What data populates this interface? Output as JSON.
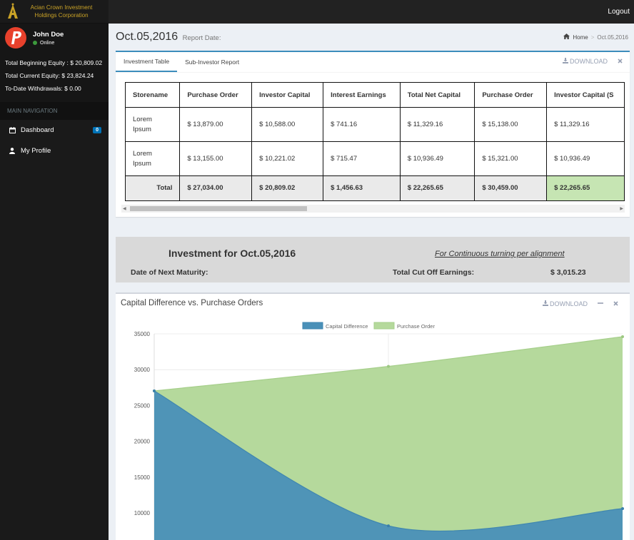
{
  "brand": {
    "name": "Acian Crown Investment Holdings Corporation",
    "logo_letter": "A"
  },
  "user": {
    "name": "John Doe",
    "status": "Online"
  },
  "equity": {
    "beginning": "Total Beginning Equity : $ 20,809.02",
    "current": "Total Current Equity: $ 23,824.24",
    "withdrawals": "To-Date Withdrawals: $ 0.00"
  },
  "nav": {
    "header": "MAIN NAVIGATION",
    "items": [
      {
        "label": "Dashboard",
        "icon": "calendar-icon",
        "badge": "0"
      },
      {
        "label": "My Profile",
        "icon": "user-icon"
      }
    ]
  },
  "topbar": {
    "logout": "Logout"
  },
  "header": {
    "title": "Oct.05,2016",
    "subtitle": "Report Date:"
  },
  "breadcrumb": {
    "home": "Home",
    "current": "Oct.05,2016"
  },
  "tabs": {
    "items": [
      "Investment Table",
      "Sub-Investor Report"
    ],
    "download": "DOWNLOAD"
  },
  "table": {
    "headers": [
      "Storename",
      "Purchase Order",
      "Investor Capital",
      "Interest Earnings",
      "Total Net Capital",
      "Purchase Order",
      "Investor Capital (S"
    ],
    "rows": [
      [
        "Lorem Ipsum",
        "$ 13,879.00",
        "$ 10,588.00",
        "$ 741.16",
        "$ 11,329.16",
        "$ 15,138.00",
        "$ 11,329.16"
      ],
      [
        "Lorem Ipsum",
        "$ 13,155.00",
        "$ 10,221.02",
        "$ 715.47",
        "$ 10,936.49",
        "$ 15,321.00",
        "$ 10,936.49"
      ]
    ],
    "total": [
      "Total",
      "$ 27,034.00",
      "$ 20,809.02",
      "$ 1,456.63",
      "$ 22,265.65",
      "$ 30,459.00",
      "$ 22,265.65"
    ]
  },
  "summary": {
    "title": "Investment for Oct.05,2016",
    "continuous": "For Continuous turning per alignment",
    "maturity": "Date of Next Maturity:",
    "cutoff_label": "Total Cut Off Earnings:",
    "cutoff_value": "$ 3,015.23"
  },
  "chart_box": {
    "title": "Capital Difference vs. Purchase Orders",
    "download": "DOWNLOAD"
  },
  "chart_data": {
    "type": "area",
    "x": [
      0,
      1,
      2
    ],
    "series": [
      {
        "name": "Capital Difference",
        "values": [
          27034,
          8200,
          10600
        ],
        "color": "#4a90b8"
      },
      {
        "name": "Purchase Order",
        "values": [
          27034,
          30459,
          34600
        ],
        "color": "#b5d99c"
      }
    ],
    "y_ticks": [
      "35000",
      "30000",
      "25000",
      "20000",
      "15000",
      "10000"
    ],
    "ylim": [
      0,
      35000
    ],
    "legend": "top"
  }
}
